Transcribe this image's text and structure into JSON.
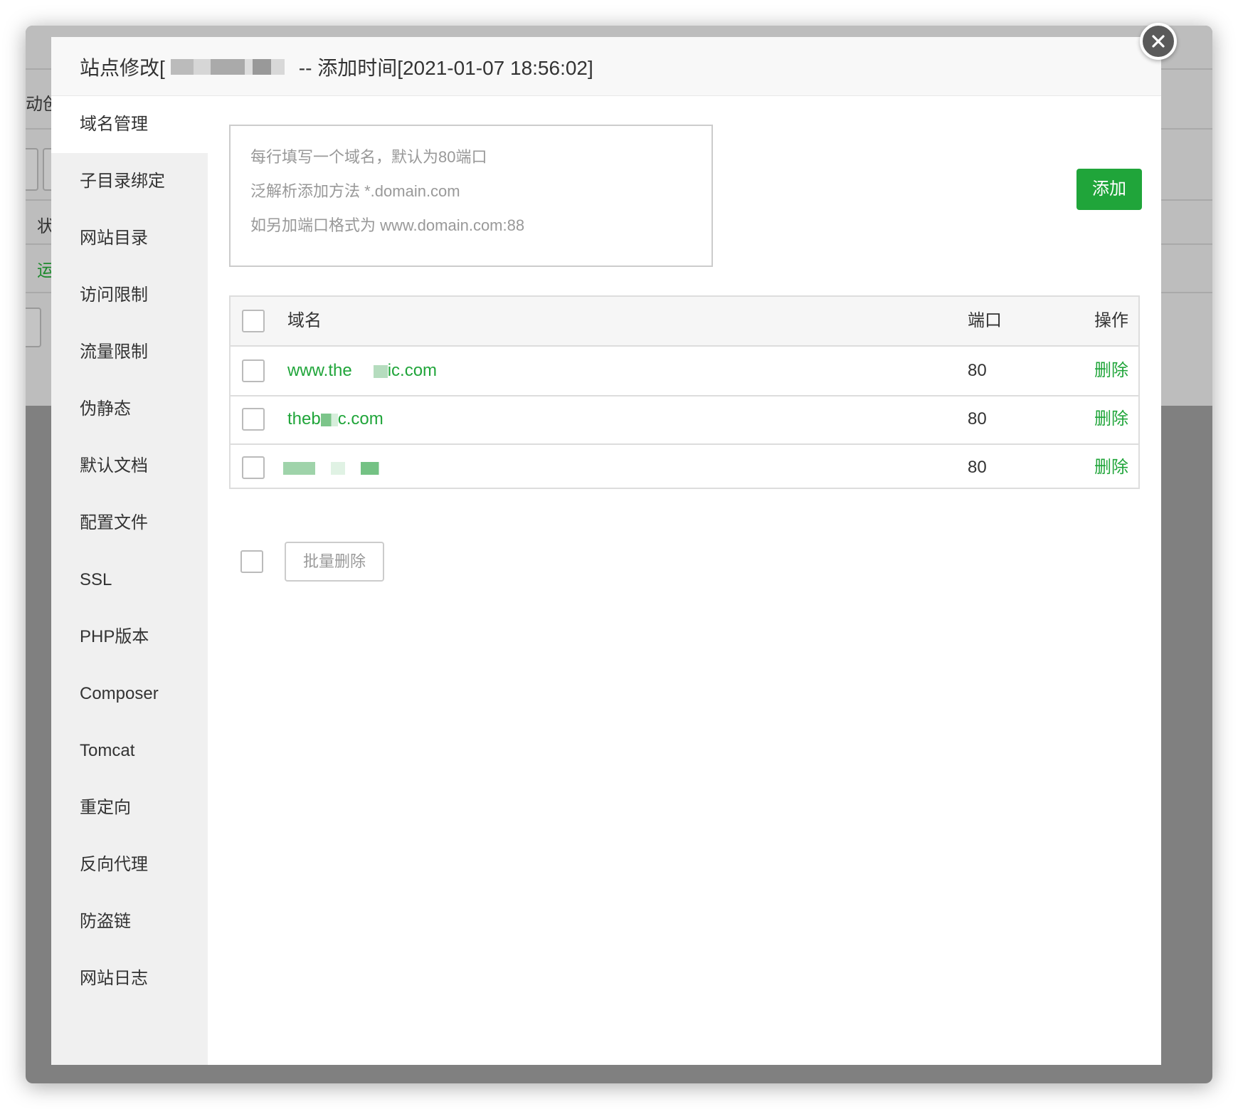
{
  "background": {
    "fragments": [
      "动创",
      "状",
      "运"
    ]
  },
  "modal": {
    "title_prefix": "站点修改[",
    "title_suffix": "-- 添加时间[2021-01-07 18:56:02]",
    "close_icon": "close-icon"
  },
  "sidebar": {
    "items": [
      {
        "label": "域名管理",
        "active": true
      },
      {
        "label": "子目录绑定"
      },
      {
        "label": "网站目录"
      },
      {
        "label": "访问限制"
      },
      {
        "label": "流量限制"
      },
      {
        "label": "伪静态"
      },
      {
        "label": "默认文档"
      },
      {
        "label": "配置文件"
      },
      {
        "label": "SSL"
      },
      {
        "label": "PHP版本"
      },
      {
        "label": "Composer"
      },
      {
        "label": "Tomcat"
      },
      {
        "label": "重定向"
      },
      {
        "label": "反向代理"
      },
      {
        "label": "防盗链"
      },
      {
        "label": "网站日志"
      }
    ]
  },
  "domain_form": {
    "placeholder_lines": [
      "每行填写一个域名，默认为80端口",
      "泛解析添加方法 *.domain.com",
      "如另加端口格式为 www.domain.com:88"
    ],
    "add_label": "添加"
  },
  "table": {
    "headers": {
      "domain": "域名",
      "port": "端口",
      "action": "操作"
    },
    "rows": [
      {
        "domain_start": "www.the",
        "domain_end": "ic.com",
        "port": "80",
        "action": "删除"
      },
      {
        "domain_start": "theb",
        "domain_end": "c.com",
        "port": "80",
        "action": "删除"
      },
      {
        "domain_start": "",
        "domain_end": "",
        "port": "80",
        "action": "删除"
      }
    ],
    "bulk_delete_label": "批量删除"
  },
  "colors": {
    "accent": "#20a53a",
    "text": "#333333",
    "muted": "#999999"
  }
}
